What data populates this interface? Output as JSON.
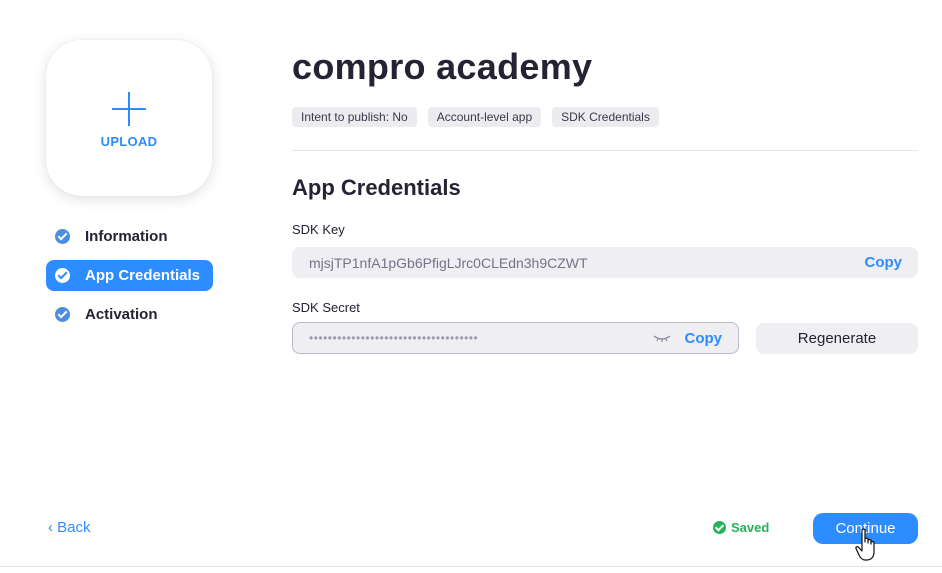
{
  "app": {
    "title": "compro academy",
    "tags": [
      "Intent to publish: No",
      "Account-level app",
      "SDK Credentials"
    ]
  },
  "upload": {
    "label": "UPLOAD",
    "icon": "plus-icon"
  },
  "sidebar": {
    "items": [
      {
        "label": "Information",
        "active": false,
        "icon": "check-circle-icon"
      },
      {
        "label": "App Credentials",
        "active": true,
        "icon": "check-circle-icon"
      },
      {
        "label": "Activation",
        "active": false,
        "icon": "check-circle-icon"
      }
    ]
  },
  "section": {
    "title": "App Credentials"
  },
  "sdk_key": {
    "label": "SDK Key",
    "value": "mjsjTP1nfA1pGb6PfigLJrc0CLEdn3h9CZWT",
    "copy_label": "Copy"
  },
  "sdk_secret": {
    "label": "SDK Secret",
    "masked_value": "••••••••••••••••••••••••••••••••••••",
    "copy_label": "Copy",
    "eye_icon": "eye-closed-icon"
  },
  "regenerate_label": "Regenerate",
  "footer": {
    "back_label": "‹ Back",
    "saved_label": "Saved",
    "continue_label": "Continue"
  },
  "colors": {
    "accent": "#2D8CFF",
    "success": "#23B35B",
    "field_bg": "#EEEEF3",
    "text": "#232333"
  }
}
